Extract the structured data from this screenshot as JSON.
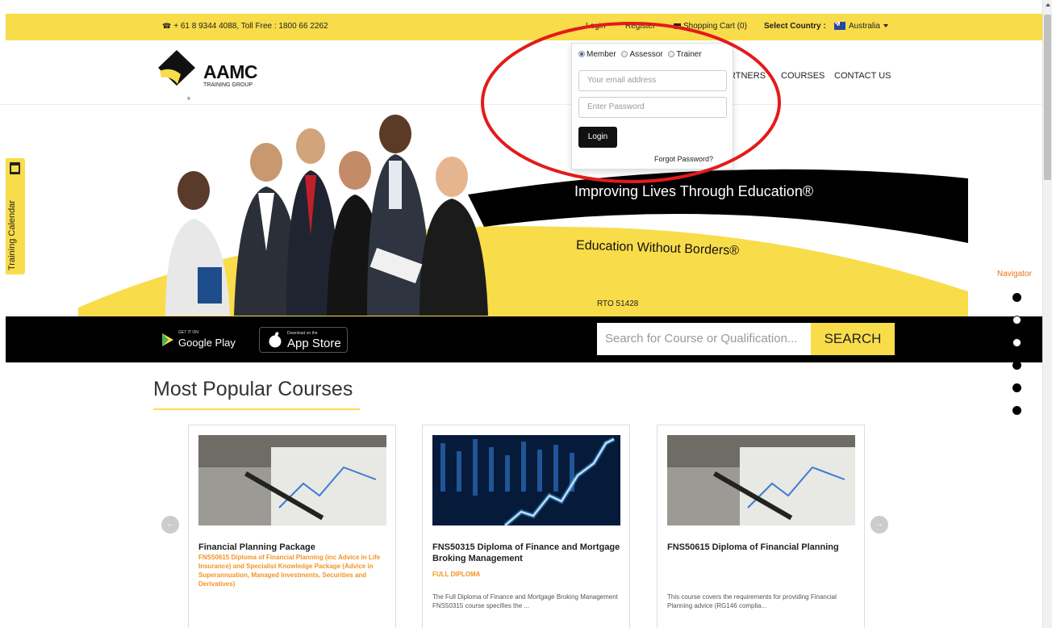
{
  "topbar": {
    "phone": "+ 61 8 9344 4088, Toll Free : 1800 66 2262",
    "login": "Login",
    "register": "Register",
    "cart": "Shopping Cart (0)",
    "country_label": "Select Country :",
    "country_value": "Australia"
  },
  "logo": {
    "name": "AAMC",
    "subtitle": "TRAINING GROUP"
  },
  "nav": {
    "partners": "RTNERS",
    "courses": "COURSES",
    "contact": "CONTACT US"
  },
  "hero": {
    "slogan1": "Improving Lives Through Education®",
    "slogan2": "Education Without Borders®",
    "rto": "RTO 51428"
  },
  "apps": {
    "play_small": "GET IT ON",
    "play_big": "Google Play",
    "apple_small": "Download on the",
    "apple_big": "App Store"
  },
  "search": {
    "placeholder": "Search for Course or Qualification...",
    "button": "SEARCH"
  },
  "side_tab": {
    "label": "Training Calendar"
  },
  "navigator": {
    "label": "Navigator",
    "dots": [
      "filled",
      "empty",
      "empty",
      "filled",
      "filled",
      "filled"
    ]
  },
  "login_dropdown": {
    "roles": [
      "Member",
      "Assessor",
      "Trainer"
    ],
    "selected_role": "Member",
    "email_placeholder": "Your email address",
    "password_placeholder": "Enter Password",
    "login_button": "Login",
    "forgot": "Forgot Password?"
  },
  "courses": {
    "section_title": "Most Popular Courses",
    "items": [
      {
        "title": "Financial Planning Package",
        "subtitle": "FNS50615 Diploma of Financial Planning (inc Advice in Life Insurance) and Specialist Knowledge Package (Advice in Superannuation, Managed Investments, Securities and Derivatives)",
        "description": ""
      },
      {
        "title": "FNS50315 Diploma of Finance and Mortgage Broking Management",
        "subtitle": "FULL DIPLOMA",
        "description": "The Full Diploma of Finance and Mortgage Broking Management FNS50315 course specifies the ..."
      },
      {
        "title": "FNS50615 Diploma of Financial Planning",
        "subtitle": "",
        "description": "This course covers the requirements for providing Financial Planning advice (RG146 complia..."
      }
    ]
  },
  "colors": {
    "brand_yellow": "#f9dc4a",
    "accent_orange": "#f39323",
    "annotation_red": "#e31b1b"
  }
}
